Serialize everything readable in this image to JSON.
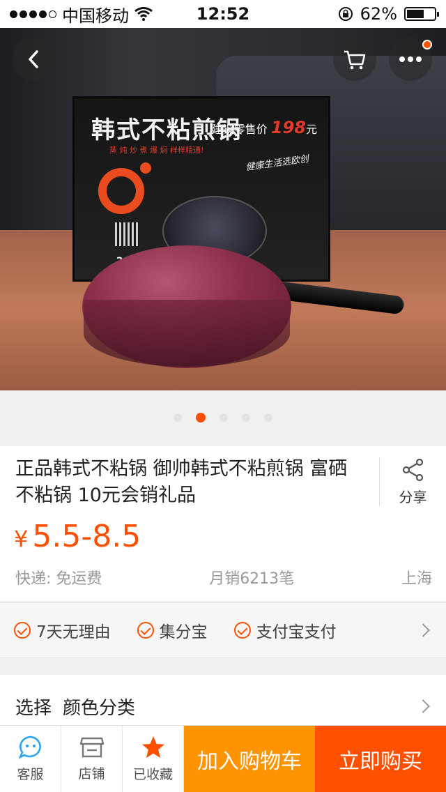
{
  "status_bar": {
    "carrier": "中国移动",
    "time": "12:52",
    "battery": "62%",
    "battery_level": 0.62
  },
  "hero": {
    "box_title": "韩式不粘煎锅",
    "box_price_prefix": "建议零售价",
    "box_price": "198",
    "box_price_suffix": "元",
    "box_subtitle": "蒸 炖 炒 煮 爆 焖  样样精通!",
    "box_slogan": "健康生活选欧创",
    "box_size": "26CM",
    "carousel": {
      "count": 5,
      "active_index": 1
    }
  },
  "product": {
    "title": "正品韩式不粘锅 御帅韩式不粘煎锅 富硒不粘锅 10元会销礼品",
    "share_label": "分享",
    "price_symbol": "¥",
    "price": "5.5-8.5",
    "shipping": "快递: 免运费",
    "monthly_sales": "月销6213笔",
    "location": "上海"
  },
  "guarantees": [
    "7天无理由",
    "集分宝",
    "支付宝支付"
  ],
  "select": {
    "label": "选择",
    "value": "颜色分类"
  },
  "tabbar": {
    "service": "客服",
    "shop": "店铺",
    "favorite": "已收藏",
    "add_to_cart": "加入购物车",
    "buy_now": "立即购买"
  },
  "colors": {
    "accent": "#ff5000",
    "cart_button": "#ff9402"
  }
}
